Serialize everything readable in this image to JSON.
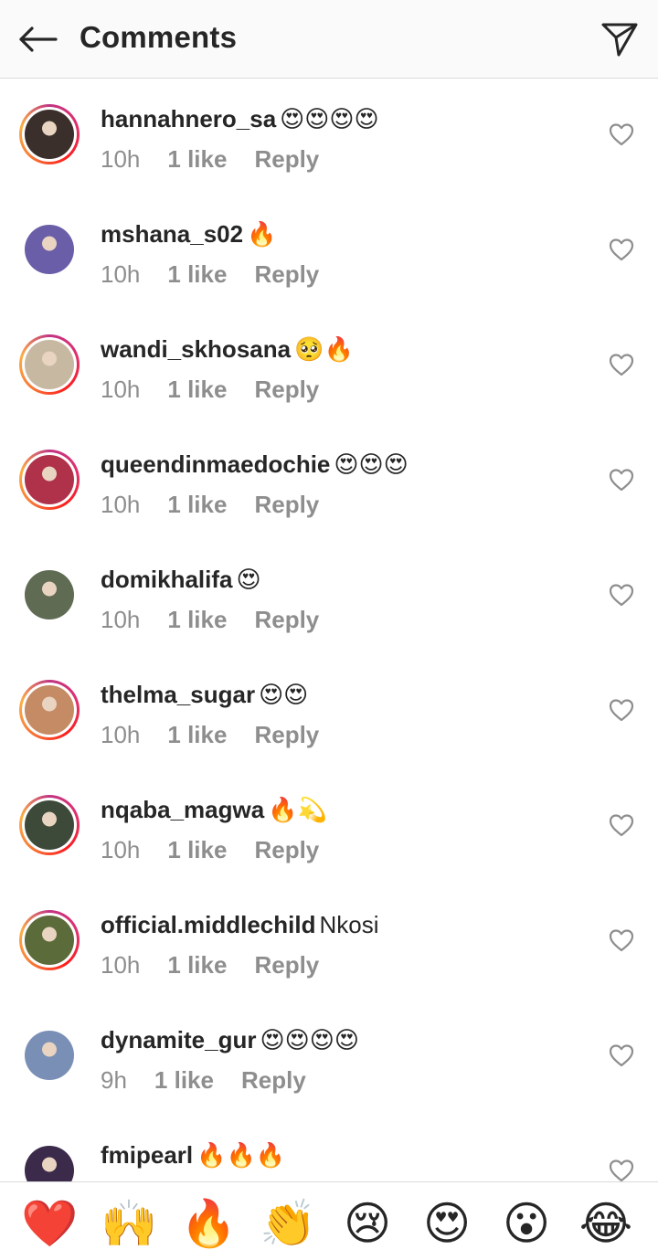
{
  "header": {
    "title": "Comments"
  },
  "comments": [
    {
      "username": "hannahnero_sa",
      "text": "😍😍😍😍",
      "time": "10h",
      "likes": "1 like",
      "reply": "Reply",
      "ring": true,
      "avatar_color": "#3a2f2b"
    },
    {
      "username": "mshana_s02",
      "text": "🔥",
      "time": "10h",
      "likes": "1 like",
      "reply": "Reply",
      "ring": false,
      "avatar_color": "#6b5ea8"
    },
    {
      "username": "wandi_skhosana",
      "text": "🥺🔥",
      "time": "10h",
      "likes": "1 like",
      "reply": "Reply",
      "ring": true,
      "avatar_color": "#c7b8a2"
    },
    {
      "username": "queendinmaedochie",
      "text": "😍😍😍",
      "time": "10h",
      "likes": "1 like",
      "reply": "Reply",
      "ring": true,
      "avatar_color": "#b0324a"
    },
    {
      "username": "domikhalifa",
      "text": "😍",
      "time": "10h",
      "likes": "1 like",
      "reply": "Reply",
      "ring": false,
      "avatar_color": "#5f6b52"
    },
    {
      "username": "thelma_sugar",
      "text": "😍😍",
      "time": "10h",
      "likes": "1 like",
      "reply": "Reply",
      "ring": true,
      "avatar_color": "#c58b64"
    },
    {
      "username": "nqaba_magwa",
      "text": "🔥💫",
      "time": "10h",
      "likes": "1 like",
      "reply": "Reply",
      "ring": true,
      "avatar_color": "#3d4a3a"
    },
    {
      "username": "official.middlechild",
      "text": "Nkosi",
      "time": "10h",
      "likes": "1 like",
      "reply": "Reply",
      "ring": true,
      "avatar_color": "#5c6b3a"
    },
    {
      "username": "dynamite_gur",
      "text": "😍😍😍😍",
      "time": "9h",
      "likes": "1 like",
      "reply": "Reply",
      "ring": false,
      "avatar_color": "#7a8fb5"
    },
    {
      "username": "fmipearl",
      "text": "🔥🔥🔥",
      "time": "",
      "likes": "",
      "reply": "",
      "ring": false,
      "avatar_color": "#3b2a4a"
    }
  ],
  "reactions": [
    "❤️",
    "🙌",
    "🔥",
    "👏",
    "😢",
    "😍",
    "😮",
    "😂"
  ],
  "icons": {
    "back": "back-arrow-icon",
    "send": "direct-send-icon",
    "like": "heart-outline-icon"
  },
  "colors": {
    "text_primary": "#262626",
    "text_secondary": "#8e8e8e",
    "divider": "#dbdbdb",
    "header_bg": "#fafafa"
  }
}
